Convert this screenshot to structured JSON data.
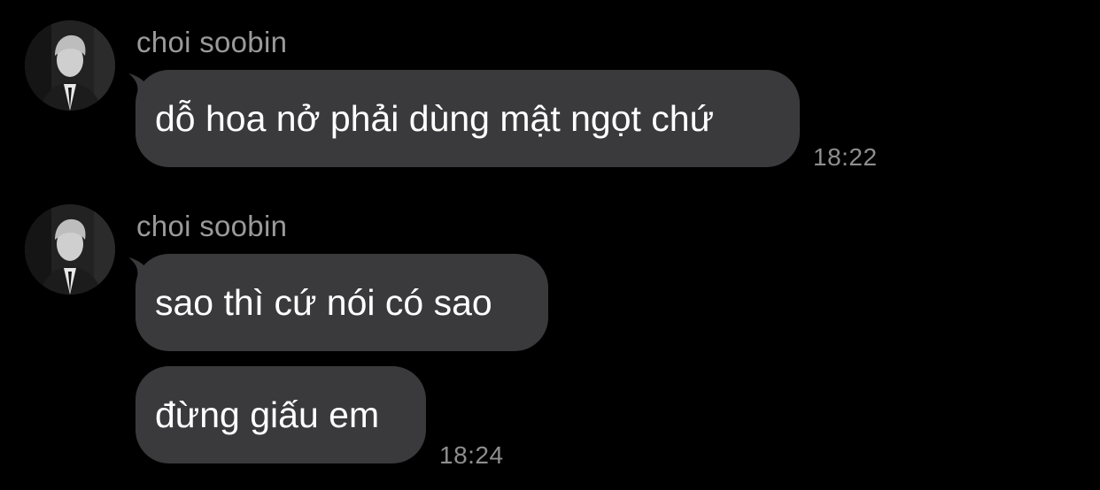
{
  "messages": [
    {
      "sender": "choi soobin",
      "avatar_icon": "profile-photo",
      "bubbles": [
        "dỗ hoa nở phải dùng mật ngọt chứ"
      ],
      "time": "18:22"
    },
    {
      "sender": "choi soobin",
      "avatar_icon": "profile-photo",
      "bubbles": [
        "sao thì cứ nói có sao",
        "đừng giấu em"
      ],
      "time": "18:24"
    }
  ],
  "colors": {
    "background": "#000000",
    "bubble": "#3a3a3c",
    "bubble_text": "#ffffff",
    "sender_text": "#9a9a9a",
    "time_text": "#8e8e8e"
  }
}
